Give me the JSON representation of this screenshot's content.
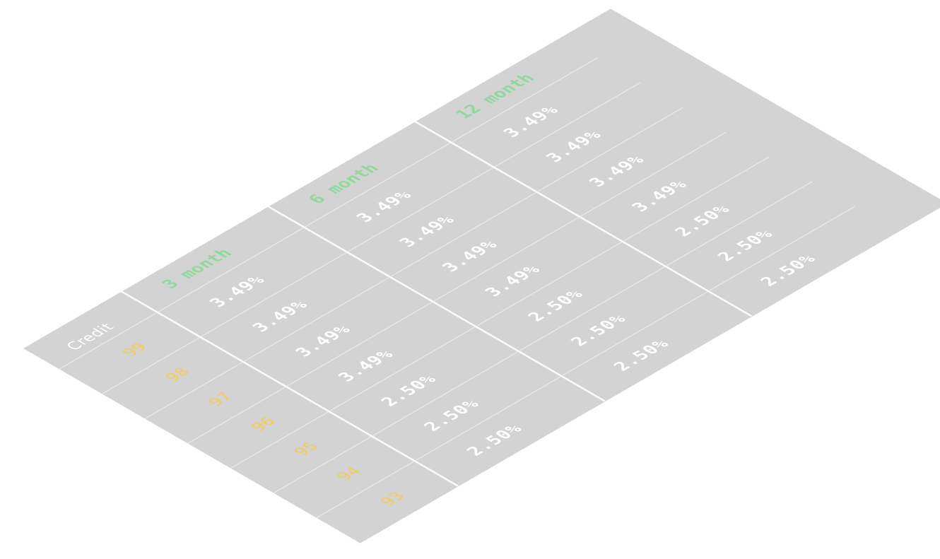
{
  "table": {
    "corner_label": "Credit",
    "columns": [
      "3 month",
      "6 month",
      "12 month"
    ],
    "rows": [
      {
        "score": "99",
        "rates": [
          "3.49%",
          "3.49%",
          "3.49%"
        ]
      },
      {
        "score": "98",
        "rates": [
          "3.49%",
          "3.49%",
          "3.49%"
        ]
      },
      {
        "score": "97",
        "rates": [
          "3.49%",
          "3.49%",
          "3.49%"
        ]
      },
      {
        "score": "96",
        "rates": [
          "3.49%",
          "3.49%",
          "3.49%"
        ]
      },
      {
        "score": "95",
        "rates": [
          "2.50%",
          "2.50%",
          "2.50%"
        ]
      },
      {
        "score": "94",
        "rates": [
          "2.50%",
          "2.50%",
          "2.50%"
        ]
      },
      {
        "score": "93",
        "rates": [
          "2.50%",
          "2.50%",
          "2.50%"
        ]
      }
    ]
  },
  "colors": {
    "surface": "#d3d3d3",
    "grid_lines": "#f2f2f2",
    "term_header": "#90d89c",
    "credit_score": "#f3cc5e",
    "rate_text": "#ffffff"
  }
}
